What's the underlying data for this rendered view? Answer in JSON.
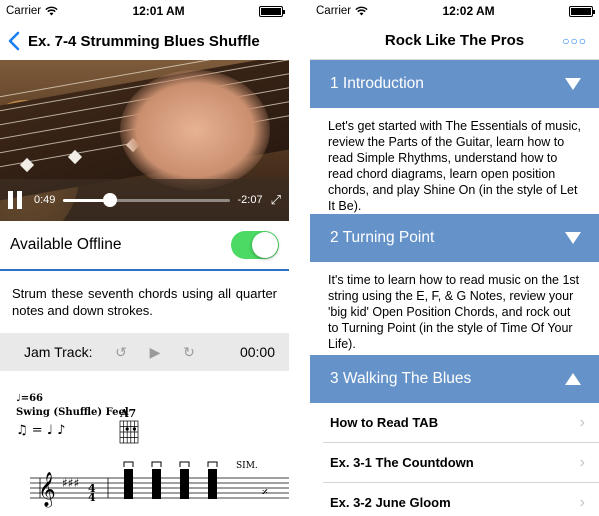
{
  "left_phone": {
    "status": {
      "carrier": "Carrier",
      "time": "12:01 AM"
    },
    "nav": {
      "back_icon": "chevron-left-icon",
      "title": "Ex. 7-4 Strumming Blues Shuffle"
    },
    "video": {
      "elapsed": "0:49",
      "remaining": "-2:07",
      "progress": 0.28
    },
    "offline": {
      "label": "Available Offline",
      "enabled": true
    },
    "description": "Strum these seventh chords using all quarter notes and down strokes.",
    "jam": {
      "label": "Jam Track:",
      "time": "00:00"
    },
    "sheet": {
      "tempo": "♩=66",
      "feel": "Swing (Shuffle) Feel",
      "swing": "♫ = ♩ ♪",
      "chord": "A7",
      "sim": "SIM."
    }
  },
  "right_phone": {
    "status": {
      "carrier": "Carrier",
      "time": "12:02 AM"
    },
    "nav": {
      "title": "Rock Like The Pros",
      "more_icon": "more-icon"
    },
    "sections": [
      {
        "title": "1 Introduction",
        "expanded": false,
        "body": "Let's get started with The Essentials of music, review the Parts of the Guitar, learn how to read Simple Rhythms, understand how to read chord diagrams, learn open position chords, and play Shine On (in the style of Let It Be)."
      },
      {
        "title": "2 Turning Point",
        "expanded": false,
        "body": "It's time to learn how to read music on the 1st string using the E, F, & G Notes, review your 'big kid' Open Position Chords, and rock out to Turning Point (in the style of Time Of Your Life)."
      },
      {
        "title": "3 Walking The Blues",
        "expanded": true
      }
    ],
    "lessons": [
      "How to Read TAB",
      "Ex. 3-1 The Countdown",
      "Ex. 3-2 June Gloom"
    ]
  },
  "colors": {
    "accent": "#1a7ff2",
    "section_header": "#6592c8",
    "toggle_on": "#4cd964",
    "divider": "#2d73c5"
  }
}
